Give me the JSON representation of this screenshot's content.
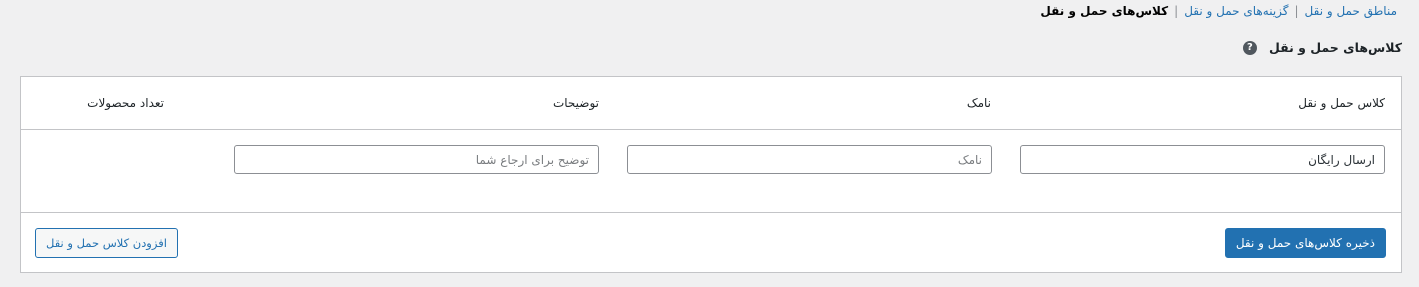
{
  "breadcrumb": {
    "zones_label": "مناطق حمل و نقل",
    "options_label": "گزینه‌های حمل و نقل",
    "classes_label": "کلاس‌های حمل و نقل",
    "separator": "|"
  },
  "section": {
    "title": "کلاس‌های حمل و نقل",
    "help_glyph": "?"
  },
  "table": {
    "columns": {
      "shipping_class": "کلاس حمل و نقل",
      "slug": "نامک",
      "description": "توضیحات",
      "product_count": "تعداد محصولات"
    },
    "row": {
      "name_value": "ارسال رایگان",
      "slug_placeholder": "نامک",
      "description_placeholder": "توضیح برای ارجاع شما"
    }
  },
  "actions": {
    "save_label": "ذخیره کلاس‌های حمل و نقل",
    "add_label": "افزودن کلاس حمل و نقل"
  },
  "colors": {
    "accent": "#2271b1",
    "background": "#f0f0f1"
  }
}
